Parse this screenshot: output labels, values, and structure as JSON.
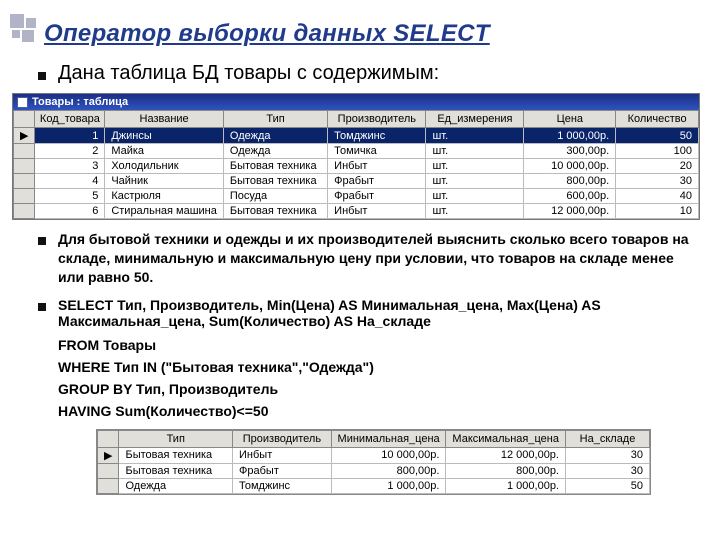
{
  "title": "Оператор выборки данных SELECT",
  "lead": "Дана таблица БД товары с содержимым:",
  "db_window": {
    "title": "Товары : таблица"
  },
  "products": {
    "headers": [
      "Код_товара",
      "Название",
      "Тип",
      "Производитель",
      "Ед_измерения",
      "Цена",
      "Количество"
    ],
    "rows": [
      {
        "id": "1",
        "name": "Джинсы",
        "type": "Одежда",
        "maker": "Томджинс",
        "unit": "шт.",
        "price": "1 000,00р.",
        "qty": "50"
      },
      {
        "id": "2",
        "name": "Майка",
        "type": "Одежда",
        "maker": "Томичка",
        "unit": "шт.",
        "price": "300,00р.",
        "qty": "100"
      },
      {
        "id": "3",
        "name": "Холодильник",
        "type": "Бытовая техника",
        "maker": "Инбыт",
        "unit": "шт.",
        "price": "10 000,00р.",
        "qty": "20"
      },
      {
        "id": "4",
        "name": "Чайник",
        "type": "Бытовая техника",
        "maker": "Фрабыт",
        "unit": "шт.",
        "price": "800,00р.",
        "qty": "30"
      },
      {
        "id": "5",
        "name": "Кастрюля",
        "type": "Посуда",
        "maker": "Фрабыт",
        "unit": "шт.",
        "price": "600,00р.",
        "qty": "40"
      },
      {
        "id": "6",
        "name": "Стиральная машина",
        "type": "Бытовая техника",
        "maker": "Инбыт",
        "unit": "шт.",
        "price": "12 000,00р.",
        "qty": "10"
      }
    ]
  },
  "task": "Для бытовой техники и одежды и их производителей выяснить сколько всего товаров на складе, минимальную и максимальную цену при условии, что товаров на складе менее или равно 50.",
  "sql": {
    "l1": "SELECT Тип, Производитель, Min(Цена) AS Минимальная_цена, Max(Цена) AS Максимальная_цена, Sum(Количество) AS На_складе",
    "l2": "FROM Товары",
    "l3": "WHERE Тип IN (\"Бытовая техника\",\"Одежда\")",
    "l4": "GROUP BY Тип, Производитель",
    "l5": "HAVING Sum(Количество)<=50"
  },
  "result": {
    "headers": [
      "Тип",
      "Производитель",
      "Минимальная_цена",
      "Максимальная_цена",
      "На_складе"
    ],
    "rows": [
      {
        "type": "Бытовая техника",
        "maker": "Инбыт",
        "min": "10 000,00р.",
        "max": "12 000,00р.",
        "qty": "30"
      },
      {
        "type": "Бытовая техника",
        "maker": "Фрабыт",
        "min": "800,00р.",
        "max": "800,00р.",
        "qty": "30"
      },
      {
        "type": "Одежда",
        "maker": "Томджинс",
        "min": "1 000,00р.",
        "max": "1 000,00р.",
        "qty": "50"
      }
    ]
  },
  "chart_data": {
    "type": "table",
    "title": "Товары",
    "columns": [
      "Код_товара",
      "Название",
      "Тип",
      "Производитель",
      "Ед_измерения",
      "Цена",
      "Количество"
    ],
    "rows": [
      [
        1,
        "Джинсы",
        "Одежда",
        "Томджинс",
        "шт.",
        1000.0,
        50
      ],
      [
        2,
        "Майка",
        "Одежда",
        "Томичка",
        "шт.",
        300.0,
        100
      ],
      [
        3,
        "Холодильник",
        "Бытовая техника",
        "Инбыт",
        "шт.",
        10000.0,
        20
      ],
      [
        4,
        "Чайник",
        "Бытовая техника",
        "Фрабыт",
        "шт.",
        800.0,
        30
      ],
      [
        5,
        "Кастрюля",
        "Посуда",
        "Фрабыт",
        "шт.",
        600.0,
        40
      ],
      [
        6,
        "Стиральная машина",
        "Бытовая техника",
        "Инбыт",
        "шт.",
        12000.0,
        10
      ]
    ],
    "result_columns": [
      "Тип",
      "Производитель",
      "Минимальная_цена",
      "Максимальная_цена",
      "На_складе"
    ],
    "result_rows": [
      [
        "Бытовая техника",
        "Инбыт",
        10000.0,
        12000.0,
        30
      ],
      [
        "Бытовая техника",
        "Фрабыт",
        800.0,
        800.0,
        30
      ],
      [
        "Одежда",
        "Томджинс",
        1000.0,
        1000.0,
        50
      ]
    ]
  }
}
